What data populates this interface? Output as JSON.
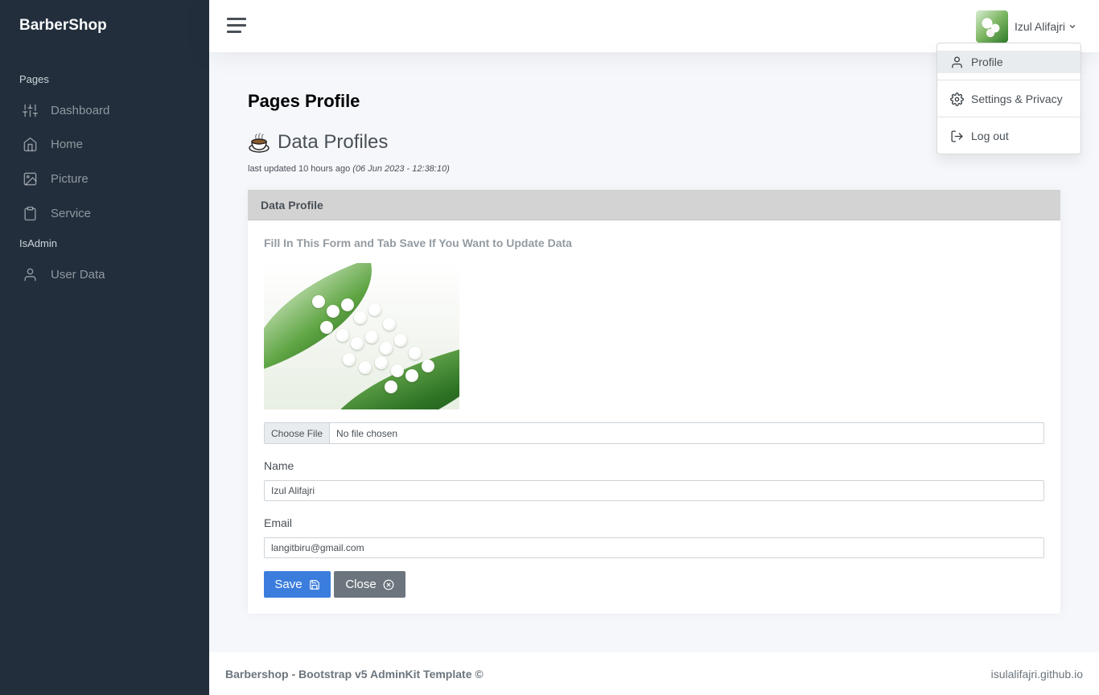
{
  "sidebar": {
    "brand": "BarberShop",
    "sections": [
      {
        "header": "Pages"
      },
      {
        "header": "IsAdmin"
      }
    ],
    "items": [
      {
        "label": "Dashboard",
        "icon": "sliders-icon"
      },
      {
        "label": "Home",
        "icon": "home-icon"
      },
      {
        "label": "Picture",
        "icon": "image-icon"
      },
      {
        "label": "Service",
        "icon": "clipboard-icon"
      },
      {
        "label": "User Data",
        "icon": "user-icon"
      }
    ]
  },
  "navbar": {
    "user_name": "Izul Alifajri",
    "dropdown": [
      {
        "label": "Profile",
        "icon": "user-icon"
      },
      {
        "label": "Settings & Privacy",
        "icon": "gear-icon"
      },
      {
        "label": "Log out",
        "icon": "log-out-icon"
      }
    ]
  },
  "main": {
    "title_bold": "Pages",
    "title_rest": "Profile",
    "section_title": "Data Profiles",
    "updated_text": "last updated 10 hours ago",
    "updated_date": "(06 Jun 2023 - 12:38:10)",
    "card": {
      "header": "Data Profile",
      "subtitle": "Fill In This Form and Tab Save If You Want to Update Data",
      "file_button": "Choose File",
      "file_status": "No file chosen",
      "name_label": "Name",
      "name_value": "Izul Alifajri",
      "email_label": "Email",
      "email_value": "langitbiru@gmail.com",
      "save_label": "Save",
      "close_label": "Close"
    }
  },
  "footer": {
    "left": "Barbershop - Bootstrap v5 AdminKit Template ©",
    "right": "isulalifajri.github.io"
  },
  "colors": {
    "sidebar_bg": "#222e3c",
    "primary": "#3b7ddd",
    "secondary": "#6c757d",
    "card_header_bg": "#d3d3d3"
  }
}
